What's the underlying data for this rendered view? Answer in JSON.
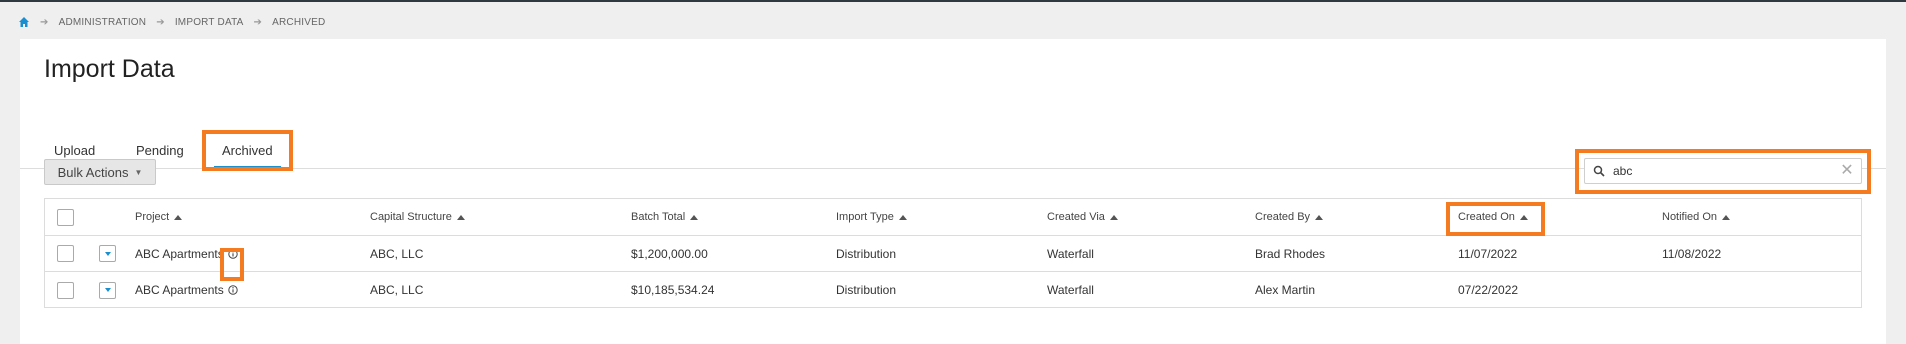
{
  "breadcrumb": {
    "items": [
      "ADMINISTRATION",
      "IMPORT DATA",
      "ARCHIVED"
    ]
  },
  "page": {
    "title": "Import Data"
  },
  "tabs": [
    {
      "label": "Upload",
      "active": false
    },
    {
      "label": "Pending",
      "active": false
    },
    {
      "label": "Archived",
      "active": true
    }
  ],
  "toolbar": {
    "bulk_actions_label": "Bulk Actions"
  },
  "search": {
    "value": "abc",
    "placeholder": ""
  },
  "table": {
    "columns": [
      "Project",
      "Capital Structure",
      "Batch Total",
      "Import Type",
      "Created Via",
      "Created By",
      "Created On",
      "Notified On"
    ],
    "rows": [
      {
        "project": "ABC Apartments",
        "capital_structure": "ABC, LLC",
        "batch_total": "$1,200,000.00",
        "import_type": "Distribution",
        "created_via": "Waterfall",
        "created_by": "Brad Rhodes",
        "created_on": "11/07/2022",
        "notified_on": "11/08/2022"
      },
      {
        "project": "ABC Apartments",
        "capital_structure": "ABC, LLC",
        "batch_total": "$10,185,534.24",
        "import_type": "Distribution",
        "created_via": "Waterfall",
        "created_by": "Alex Martin",
        "created_on": "07/22/2022",
        "notified_on": ""
      }
    ]
  },
  "colors": {
    "accent": "#1a8fd0",
    "highlight": "#f47b20"
  }
}
